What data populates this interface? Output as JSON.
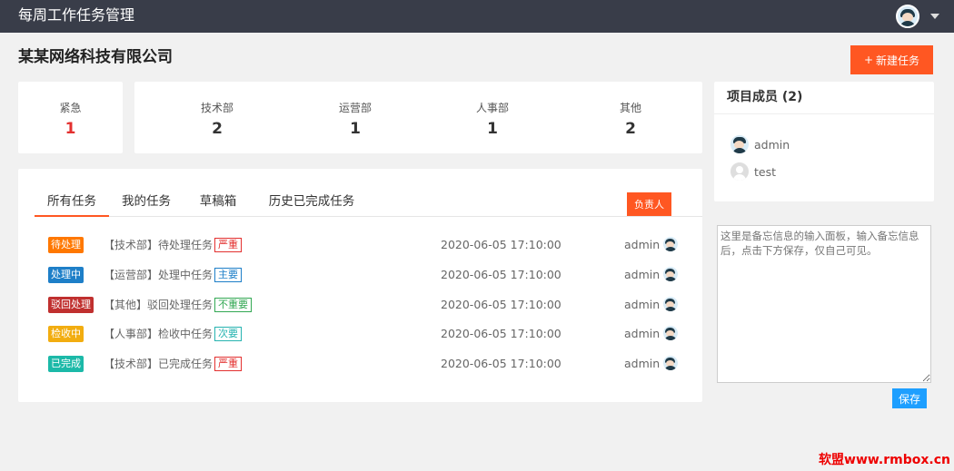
{
  "app": {
    "title": "每周工作任务管理"
  },
  "company": {
    "name": "某某网络科技有限公司"
  },
  "actions": {
    "new_task_icon": "+",
    "new_task_label": "新建任务"
  },
  "stats": [
    {
      "label": "紧急",
      "value": "1"
    },
    {
      "label": "技术部",
      "value": "2"
    },
    {
      "label": "运营部",
      "value": "1"
    },
    {
      "label": "人事部",
      "value": "1"
    },
    {
      "label": "其他",
      "value": "2"
    }
  ],
  "tabs": [
    {
      "label": "所有任务",
      "active": true
    },
    {
      "label": "我的任务",
      "active": false
    },
    {
      "label": "草稿箱",
      "active": false
    },
    {
      "label": "历史已完成任务",
      "active": false
    }
  ],
  "owner_button": "负责人",
  "tasks": [
    {
      "status": "待处理",
      "status_color": "#ff7800",
      "name": "【技术部】待处理任务",
      "priority": "严重",
      "priority_color": "#e3302f",
      "time": "2020-06-05 17:10:00",
      "user": "admin"
    },
    {
      "status": "处理中",
      "status_color": "#1e7fc8",
      "name": "【运营部】处理中任务",
      "priority": "主要",
      "priority_color": "#1e7fc8",
      "time": "2020-06-05 17:10:00",
      "user": "admin"
    },
    {
      "status": "驳回处理",
      "status_color": "#c0302f",
      "name": "【其他】驳回处理任务",
      "priority": "不重要",
      "priority_color": "#33a853",
      "time": "2020-06-05 17:10:00",
      "user": "admin"
    },
    {
      "status": "检收中",
      "status_color": "#f2ad10",
      "name": "【人事部】检收中任务",
      "priority": "次要",
      "priority_color": "#26b3b0",
      "time": "2020-06-05 17:10:00",
      "user": "admin"
    },
    {
      "status": "已完成",
      "status_color": "#1cb9a8",
      "name": "【技术部】已完成任务",
      "priority": "严重",
      "priority_color": "#e3302f",
      "time": "2020-06-05 17:10:00",
      "user": "admin"
    }
  ],
  "members": {
    "title": "项目成员 (2)",
    "list": [
      {
        "name": "admin",
        "avatar": "avatar-icon"
      },
      {
        "name": "test",
        "avatar": "default-avatar-icon"
      }
    ]
  },
  "memo": {
    "placeholder": "这里是备忘信息的输入面板，输入备忘信息后，点击下方保存，仅自己可见。",
    "save_label": "保存"
  },
  "watermark": "软盟www.rmbox.cn",
  "colors": {
    "topbar": "#393d49",
    "accent": "#ff5722",
    "save": "#1e9fff",
    "urgent": "#e3302f"
  }
}
